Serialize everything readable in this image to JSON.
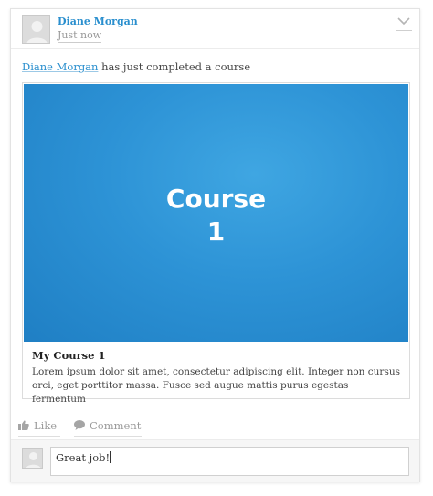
{
  "post": {
    "author": "Diane Morgan",
    "time": "Just now",
    "activity_suffix": "has just completed a course"
  },
  "course": {
    "image_title_line1": "Course",
    "image_title_line2": "1",
    "title": "My Course 1",
    "description": "Lorem ipsum dolor sit amet, consectetur adipiscing elit. Integer non cursus orci, eget porttitor massa. Fusce sed augue mattis purus egestas fermentum",
    "image_color": "#2d93d6"
  },
  "actions": {
    "like_label": "Like",
    "comment_label": "Comment"
  },
  "comment_box": {
    "value": "Great job!"
  },
  "icons": [
    "avatar-placeholder-icon",
    "chevron-down-icon",
    "thumbs-up-icon",
    "speech-bubble-icon"
  ],
  "colors": {
    "link": "#2a8fce",
    "muted": "#9a9a9a"
  }
}
